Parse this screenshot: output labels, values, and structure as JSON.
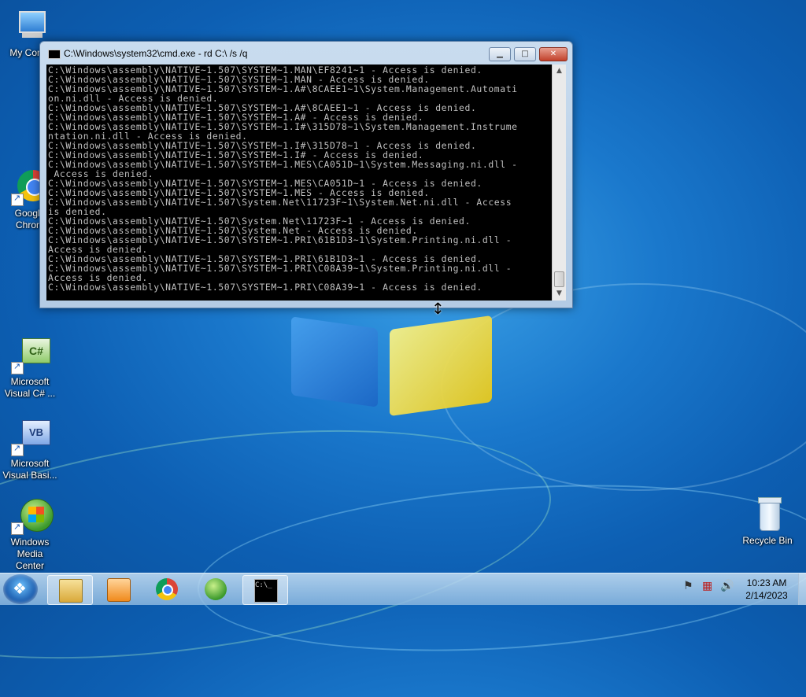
{
  "desktop": {
    "icons": [
      {
        "label": "My Comp",
        "icon": "computer-icon"
      },
      {
        "label": "Google Chrom",
        "icon": "chrome-icon"
      },
      {
        "label": "Microsoft Visual C# ...",
        "icon": "visual-csharp-icon"
      },
      {
        "label": "Microsoft Visual Basi...",
        "icon": "visual-basic-icon"
      },
      {
        "label": "Windows Media Center",
        "icon": "media-center-icon"
      },
      {
        "label": "Recycle Bin",
        "icon": "recycle-bin-icon"
      }
    ]
  },
  "window": {
    "title": "C:\\Windows\\system32\\cmd.exe - rd  C:\\ /s /q",
    "min_label": "▁",
    "max_label": "□",
    "close_label": "✕",
    "console_lines": [
      "C:\\Windows\\assembly\\NATIVE~1.507\\SYSTEM~1.MAN\\EF8241~1 - Access is denied.",
      "C:\\Windows\\assembly\\NATIVE~1.507\\SYSTEM~1.MAN - Access is denied.",
      "C:\\Windows\\assembly\\NATIVE~1.507\\SYSTEM~1.A#\\8CAEE1~1\\System.Management.Automati",
      "on.ni.dll - Access is denied.",
      "C:\\Windows\\assembly\\NATIVE~1.507\\SYSTEM~1.A#\\8CAEE1~1 - Access is denied.",
      "C:\\Windows\\assembly\\NATIVE~1.507\\SYSTEM~1.A# - Access is denied.",
      "C:\\Windows\\assembly\\NATIVE~1.507\\SYSTEM~1.I#\\315D78~1\\System.Management.Instrume",
      "ntation.ni.dll - Access is denied.",
      "C:\\Windows\\assembly\\NATIVE~1.507\\SYSTEM~1.I#\\315D78~1 - Access is denied.",
      "C:\\Windows\\assembly\\NATIVE~1.507\\SYSTEM~1.I# - Access is denied.",
      "C:\\Windows\\assembly\\NATIVE~1.507\\SYSTEM~1.MES\\CA051D~1\\System.Messaging.ni.dll -",
      " Access is denied.",
      "C:\\Windows\\assembly\\NATIVE~1.507\\SYSTEM~1.MES\\CA051D~1 - Access is denied.",
      "C:\\Windows\\assembly\\NATIVE~1.507\\SYSTEM~1.MES - Access is denied.",
      "C:\\Windows\\assembly\\NATIVE~1.507\\System.Net\\11723F~1\\System.Net.ni.dll - Access",
      "is denied.",
      "C:\\Windows\\assembly\\NATIVE~1.507\\System.Net\\11723F~1 - Access is denied.",
      "C:\\Windows\\assembly\\NATIVE~1.507\\System.Net - Access is denied.",
      "C:\\Windows\\assembly\\NATIVE~1.507\\SYSTEM~1.PRI\\61B1D3~1\\System.Printing.ni.dll -",
      "Access is denied.",
      "C:\\Windows\\assembly\\NATIVE~1.507\\SYSTEM~1.PRI\\61B1D3~1 - Access is denied.",
      "C:\\Windows\\assembly\\NATIVE~1.507\\SYSTEM~1.PRI\\C08A39~1\\System.Printing.ni.dll -",
      "Access is denied.",
      "C:\\Windows\\assembly\\NATIVE~1.507\\SYSTEM~1.PRI\\C08A39~1 - Access is denied."
    ]
  },
  "taskbar": {
    "items": [
      {
        "icon": "explorer-icon"
      },
      {
        "icon": "media-player-icon"
      },
      {
        "icon": "chrome-icon"
      },
      {
        "icon": "media-center-icon"
      },
      {
        "icon": "cmd-icon",
        "active": true
      }
    ],
    "clock_time": "10:23 AM",
    "clock_date": "2/14/2023"
  }
}
